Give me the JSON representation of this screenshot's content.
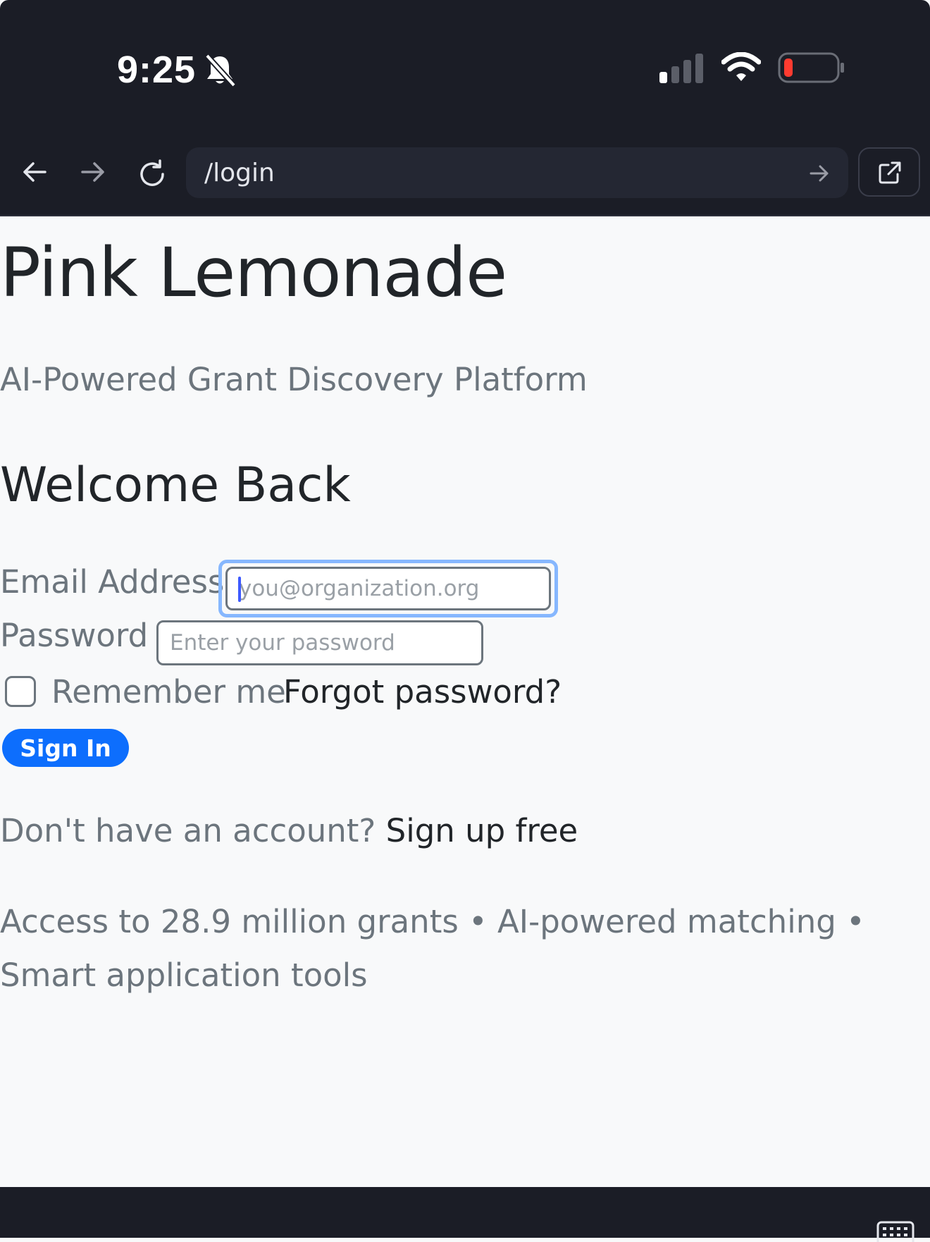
{
  "status_bar": {
    "time": "9:25",
    "icons": [
      "bell-slash-icon",
      "cellular-signal-icon",
      "wifi-icon",
      "battery-low-icon"
    ],
    "battery_color": "#ff3b30"
  },
  "browser": {
    "url": "/login",
    "icons": [
      "back-arrow-icon",
      "forward-arrow-icon",
      "reload-icon",
      "go-arrow-icon",
      "open-external-icon"
    ]
  },
  "page": {
    "app_title": "Pink Lemonade",
    "tagline": "AI-Powered Grant Discovery Platform",
    "heading": "Welcome Back",
    "form": {
      "email_label": "Email Address",
      "email_placeholder": "you@organization.org",
      "email_value": "",
      "password_label": "Password",
      "password_placeholder": "Enter your password",
      "password_value": "",
      "remember_label": "Remember me",
      "remember_checked": false,
      "forgot_link": "Forgot password?",
      "submit_label": "Sign In"
    },
    "signup_prompt": "Don't have an account?",
    "signup_link": "Sign up free",
    "features": "Access to 28.9 million grants • AI-powered matching • Smart application tools"
  },
  "colors": {
    "primary": "#0d6efd",
    "focus_ring": "#86b7fe",
    "chrome_dark": "#1b1d26",
    "page_background": "#f8f9fa"
  },
  "bottom_bar": {
    "icons": [
      "keyboard-icon"
    ]
  }
}
